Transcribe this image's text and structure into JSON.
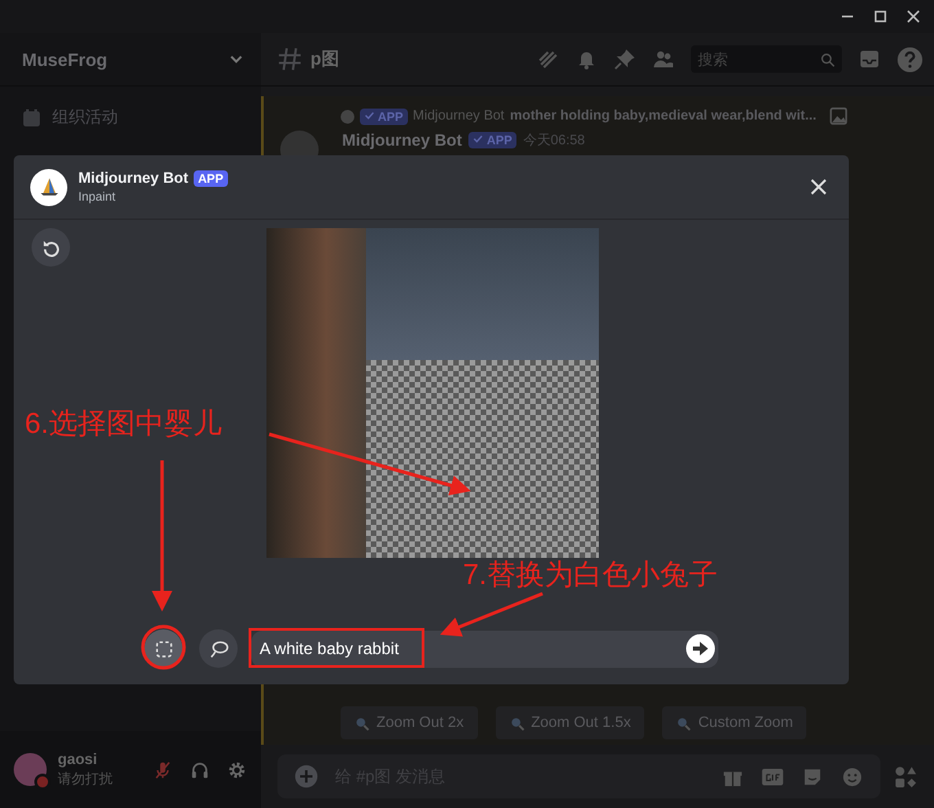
{
  "server": {
    "name": "MuseFrog"
  },
  "sidebar": {
    "items": [
      {
        "label": "组织活动"
      }
    ]
  },
  "channel": {
    "name": "p图"
  },
  "search": {
    "placeholder": "搜索"
  },
  "message": {
    "reply": {
      "author": "Midjourney Bot",
      "badge": "APP",
      "text": "mother holding baby,medieval wear,blend wit..."
    },
    "author": "Midjourney Bot",
    "badge": "APP",
    "time": "今天06:58"
  },
  "actions": [
    "Zoom Out 2x",
    "Zoom Out 1.5x",
    "Custom Zoom"
  ],
  "composer": {
    "placeholder": "给 #p图 发消息"
  },
  "user": {
    "name": "gaosi",
    "status": "请勿打扰"
  },
  "modal": {
    "bot": "Midjourney Bot",
    "badge": "APP",
    "subtitle": "Inpaint",
    "prompt": "A white baby rabbit",
    "tools": [
      {
        "kind": "rectangle",
        "selected": true
      },
      {
        "kind": "lasso",
        "selected": false
      }
    ]
  },
  "annotations": [
    {
      "text": "6.选择图中婴儿"
    },
    {
      "text": "7.替换为白色小兔子"
    }
  ]
}
